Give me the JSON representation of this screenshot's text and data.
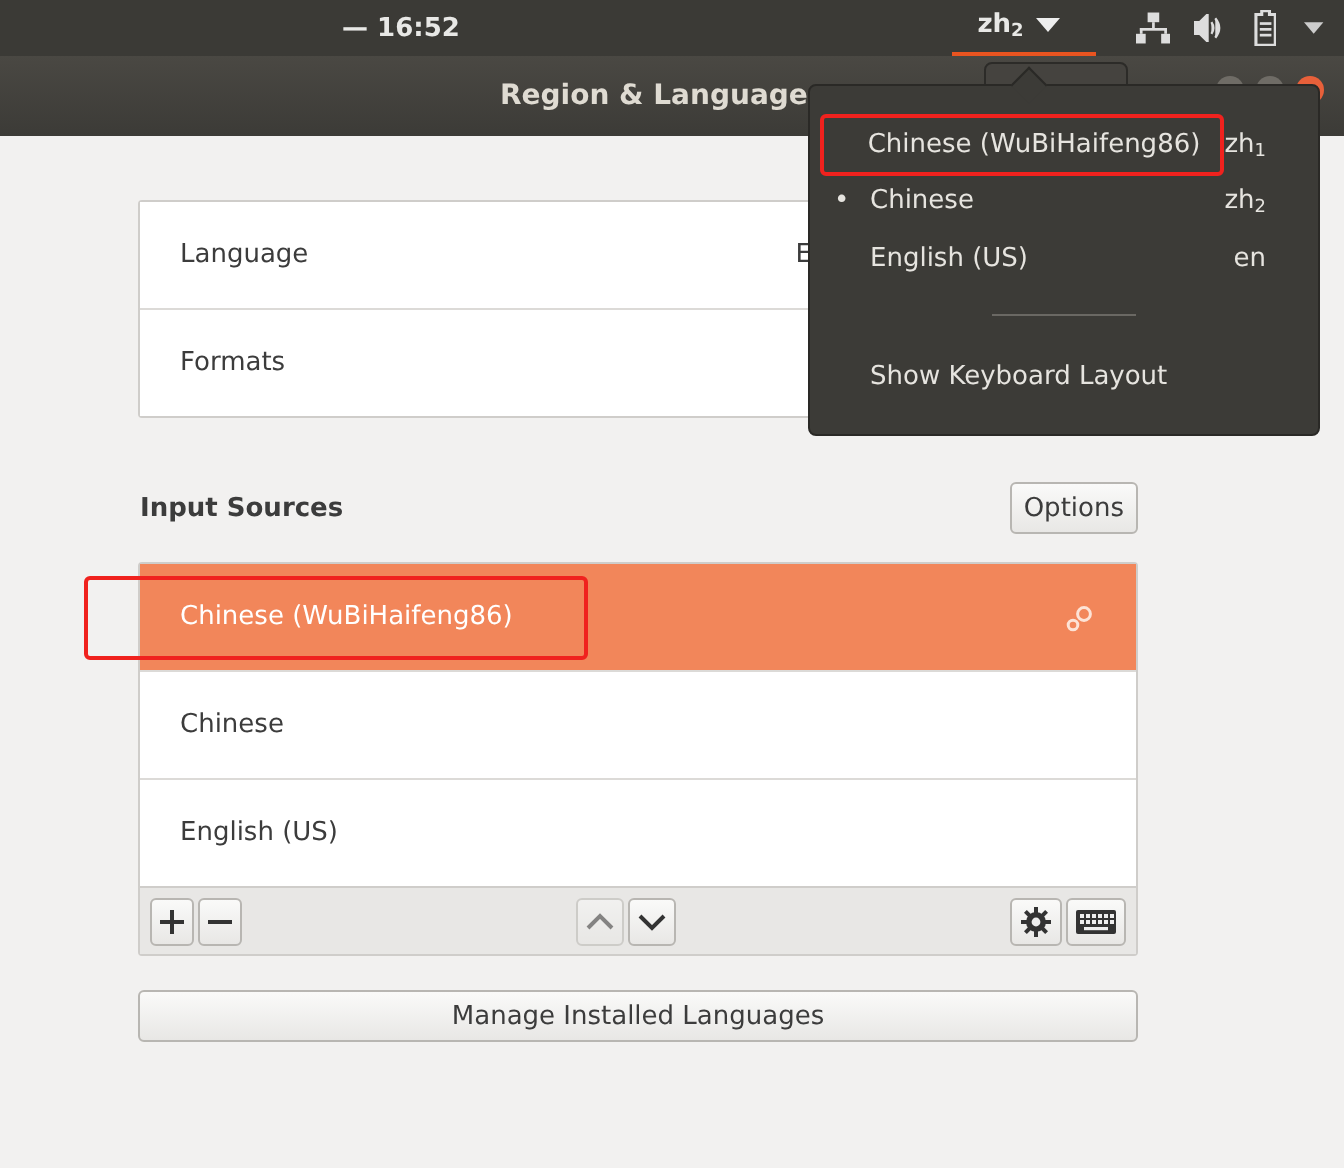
{
  "top_bar": {
    "clock": "— 16:52",
    "input_indicator": "zh$_{2}$"
  },
  "window": {
    "title": "Region & Language"
  },
  "settings": [
    {
      "label": "Language",
      "value": "E"
    },
    {
      "label": "Formats"
    }
  ],
  "input_sources": {
    "heading": "Input Sources",
    "options_button": "Options",
    "items": [
      {
        "label": "Chinese (WuBiHaifeng86)",
        "selected": true,
        "has_settings": true,
        "highlighted": true
      },
      {
        "label": "Chinese",
        "selected": false,
        "has_settings": false,
        "highlighted": false
      },
      {
        "label": "English (US)",
        "selected": false,
        "has_settings": false,
        "highlighted": false
      }
    ],
    "up_enabled": false,
    "down_enabled": true
  },
  "manage_button": "Manage Installed Languages",
  "menu": {
    "items": [
      {
        "label": "Chinese (WuBiHaifeng86)",
        "short": "zh$_{1}$",
        "highlighted": true
      },
      {
        "marker": "•",
        "label": "Chinese",
        "short": "zh$_{2}$",
        "highlighted": false
      },
      {
        "label": "English (US)",
        "short": "en",
        "highlighted": false
      }
    ],
    "extra": "Show Keyboard Layout"
  }
}
